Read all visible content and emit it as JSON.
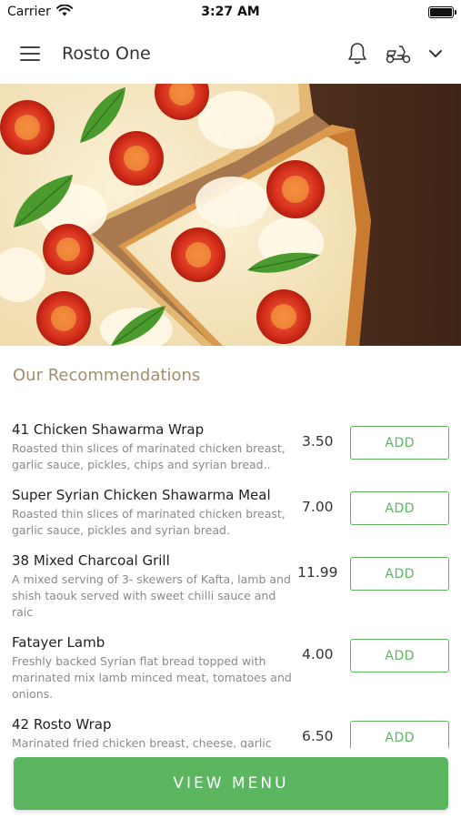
{
  "status_bar": {
    "carrier": "Carrier",
    "time": "3:27 AM"
  },
  "header": {
    "title": "Rosto One",
    "icons": [
      "menu-icon",
      "bell-icon",
      "delivery-scooter-icon",
      "chevron-down-icon"
    ]
  },
  "hero": {
    "image": "pizza-photo"
  },
  "recommendations": {
    "title": "Our Recommendations",
    "add_label": "ADD",
    "items": [
      {
        "name": "41 Chicken Shawarma Wrap",
        "description": "Roasted thin slices of marinated chicken breast, garlic sauce, pickles, chips and syrian bread..",
        "price": "3.50"
      },
      {
        "name": "Super Syrian Chicken Shawarma Meal",
        "description": "Roasted thin slices of marinated chicken breast, garlic sauce, pickles and syrian bread.",
        "price": "7.00"
      },
      {
        "name": "38 Mixed Charcoal Grill",
        "description": "A mixed serving of 3- skewers of Kafta, lamb and shish taouk served with sweet chilli sauce and raic",
        "price": "11.99"
      },
      {
        "name": "Fatayer Lamb",
        "description": "Freshly backed Syrian flat bread topped with marinated mix lamb minced meat, tomatoes and onions.",
        "price": "4.00"
      },
      {
        "name": "42 Rosto Wrap",
        "description": "Marinated fried chicken breast, cheese, garlic",
        "price": "6.50"
      }
    ]
  },
  "footer": {
    "view_menu_label": "VIEW MENU"
  },
  "colors": {
    "accent_green": "#5cb660",
    "section_title": "#a08f6b"
  }
}
